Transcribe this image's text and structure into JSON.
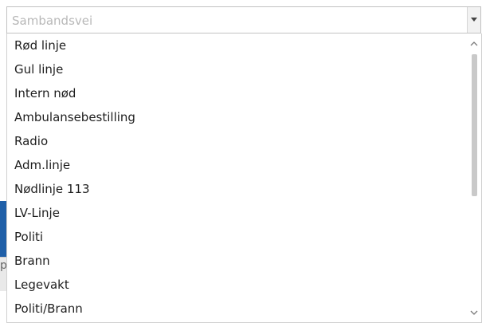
{
  "select": {
    "placeholder": "Sambandsvei",
    "arrow_icon": "chevron-down-icon"
  },
  "dropdown": {
    "items": [
      {
        "label": "Rød linje"
      },
      {
        "label": "Gul linje"
      },
      {
        "label": "Intern nød"
      },
      {
        "label": "Ambulansebestilling"
      },
      {
        "label": "Radio"
      },
      {
        "label": "Adm.linje"
      },
      {
        "label": "Nødlinje 113"
      },
      {
        "label": "LV-Linje"
      },
      {
        "label": "Politi"
      },
      {
        "label": "Brann"
      },
      {
        "label": "Legevakt"
      },
      {
        "label": "Politi/Brann"
      }
    ],
    "scrollbar": {
      "up_icon": "chevron-up-icon",
      "down_icon": "chevron-down-icon"
    }
  },
  "background": {
    "partial_letter": "p"
  },
  "colors": {
    "accent_blue": "#1f5fa8",
    "placeholder_text": "#b8b8b8",
    "item_text": "#1e1e1e"
  }
}
